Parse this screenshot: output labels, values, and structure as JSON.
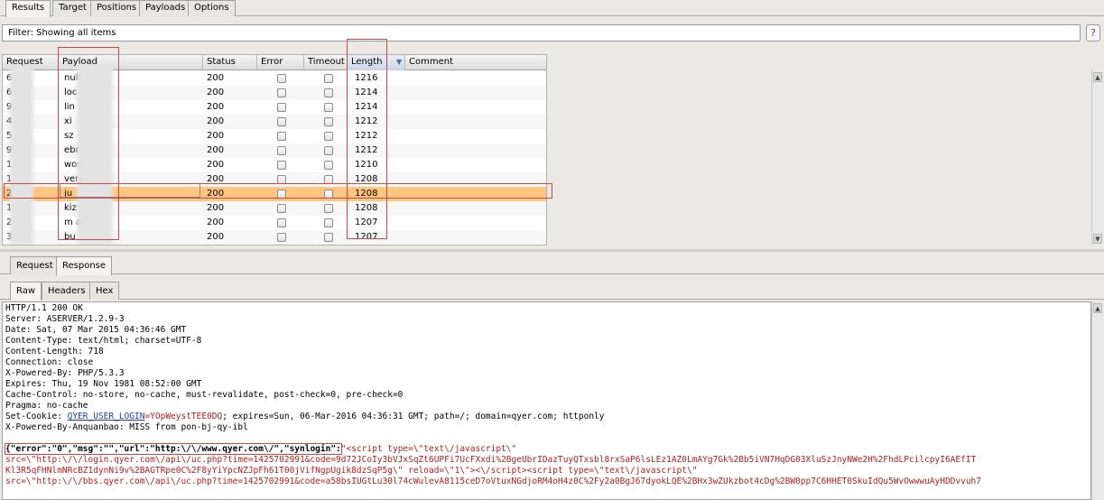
{
  "top_tabs": [
    "Results",
    "Target",
    "Positions",
    "Payloads",
    "Options"
  ],
  "filter": {
    "label": "Filter: Showing all items",
    "help": "?"
  },
  "table": {
    "headers": [
      "Request",
      "Payload",
      "Status",
      "Error",
      "Timeout",
      "Length",
      "Comment"
    ],
    "rows": [
      {
        "request": "6",
        "payload": "null",
        "status": "200",
        "length": "1216"
      },
      {
        "request": "6",
        "payload": "loc",
        "status": "200",
        "length": "1214"
      },
      {
        "request": "9",
        "payload": "lin",
        "status": "200",
        "length": "1214"
      },
      {
        "request": "4",
        "payload": "xi",
        "status": "200",
        "length": "1212"
      },
      {
        "request": "5",
        "payload": "sz",
        "status": "200",
        "length": "1212"
      },
      {
        "request": "9",
        "payload": "ebr",
        "status": "200",
        "length": "1212"
      },
      {
        "request": "1",
        "payload": "wos",
        "status": "200",
        "length": "1210"
      },
      {
        "request": "1",
        "payload": "vera",
        "status": "200",
        "length": "1208"
      },
      {
        "request": "2",
        "payload": "ju",
        "status": "200",
        "length": "1208",
        "selected": true
      },
      {
        "request": "1",
        "payload": "kiz",
        "status": "200",
        "length": "1208"
      },
      {
        "request": "2",
        "payload": "m      a",
        "status": "200",
        "length": "1207"
      },
      {
        "request": "3",
        "payload": "bu",
        "status": "200",
        "length": "1207"
      }
    ]
  },
  "req_tabs": [
    "Request",
    "Response"
  ],
  "view_tabs": [
    "Raw",
    "Headers",
    "Hex"
  ],
  "response": {
    "headers": [
      "HTTP/1.1 200 OK",
      "Server: ASERVER/1.2.9-3",
      "Date: Sat, 07 Mar 2015 04:36:46 GMT",
      "Content-Type: text/html; charset=UTF-8",
      "Content-Length: 718",
      "Connection: close",
      "X-Powered-By: PHP/5.3.3",
      "Expires: Thu, 19 Nov 1981 08:52:00 GMT",
      "Cache-Control: no-store, no-cache, must-revalidate, post-check=0, pre-check=0",
      "Pragma: no-cache"
    ],
    "cookie_prefix": "Set-Cookie: ",
    "cookie_name": "QYER_USER_LOGIN",
    "cookie_value": "=YOpWeystTEE0DQ",
    "cookie_suffix": "; expires=Sun, 06-Mar-2016 04:36:31 GMT; path=/; domain=qyer.com; httponly",
    "powered_by": "X-Powered-By-Anquanbao: MISS from pon-bj-qy-ibl",
    "json_head": "{\"error\":\"0\",\"msg\":\"\",\"url\":\"http:\\/\\/www.qyer.com\\/\",\"synlogin\":",
    "body_lines": [
      "\"<script type=\\\"text\\/javascript\\\"",
      "src=\\\"http:\\/\\/login.qyer.com\\/api\\/uc.php?time=1425702991&code=9d72JCoIy3bVJxSqZt6UPFi7UcFXxdi%2BgeUbrIDazTuyQTxsbl8rxSaP6lsLEz1AZ0LmAYg7Gk%2Bb5iVN7HqDG03XluSzJnyNWe2H%2FhdLPcilcpyI6AEfIT",
      "Kl3R5qFHNlmNRcBZ1dynNi9v%2BAGTRpe0C%2F8yYiYpcNZJpFh61T00jVifNgpUgik8dzSqP5g\\\" reload=\\\"1\\\"><\\/script><script type=\\\"text\\/javascript\\\"",
      "src=\\\"http:\\/\\/bbs.qyer.com\\/api\\/uc.php?time=1425702991&code=a58bsIUGtLu30l74cWulevA8115ceD7oVtuxNGdjoRM4oH4z0C%2Fy2a0BgJ67dyokLQE%2BHx3wZUkzbot4cDg%2BW0pp7C6HHET0SkuIdQu5WvOwwwuAyHDDvvuh7"
    ]
  }
}
